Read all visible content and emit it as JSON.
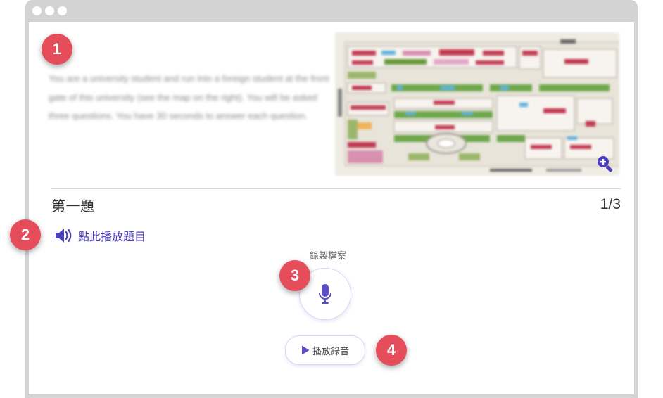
{
  "instructions": "You are a university student and run into a foreign student at the front gate of this university (see the map on the right). You will be asked three questions. You  have 30 seconds to answer each question.",
  "question": {
    "title": "第一題",
    "counter": "1/3"
  },
  "play_question_label": "點此播放題目",
  "record": {
    "caption": "錄製檔案"
  },
  "playback_label": "播放錄音",
  "callouts": [
    "1",
    "2",
    "3",
    "4"
  ],
  "colors": {
    "accent": "#4b3fbf",
    "badge": "#e64d5a",
    "frame": "#d3d3d3"
  },
  "icons": {
    "zoom": "zoom-in-icon",
    "speaker": "speaker-icon",
    "mic": "microphone-icon",
    "play": "play-icon"
  }
}
